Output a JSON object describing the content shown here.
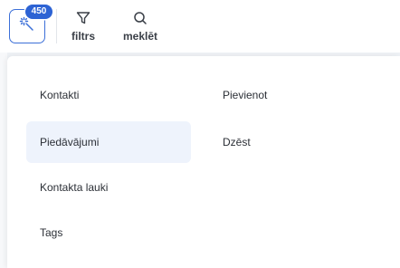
{
  "toolbar": {
    "badge_count": "450",
    "filter_label": "filtrs",
    "search_label": "meklēt"
  },
  "menu": {
    "left_items": [
      {
        "label": "Kontakti"
      },
      {
        "label": "Piedāvājumi",
        "active": true
      },
      {
        "label": "Kontakta lauki"
      },
      {
        "label": "Tags"
      }
    ],
    "right_items": [
      {
        "label": "Pievienot"
      },
      {
        "label": "Dzēst"
      }
    ]
  },
  "icons": {
    "magic": "magic-wand-icon",
    "filter": "filter-icon",
    "search": "search-icon"
  },
  "colors": {
    "accent": "#2d63d4",
    "active_item_bg": "#eef3fc"
  }
}
